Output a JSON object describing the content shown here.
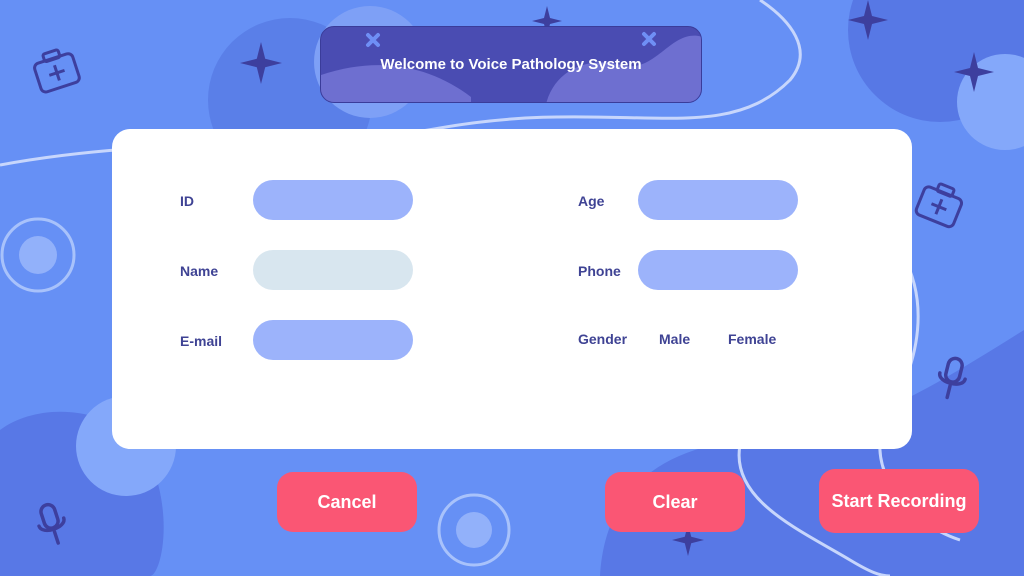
{
  "header": {
    "title": "Welcome to Voice Pathology System"
  },
  "form": {
    "id_label": "ID",
    "name_label": "Name",
    "email_label": "E-mail",
    "age_label": "Age",
    "phone_label": "Phone",
    "gender_label": "Gender",
    "gender_male": "Male",
    "gender_female": "Female",
    "id_value": "",
    "name_value": "",
    "email_value": "",
    "age_value": "",
    "phone_value": ""
  },
  "buttons": {
    "cancel": "Cancel",
    "clear": "Clear",
    "start_recording": "Start Recording"
  },
  "colors": {
    "background": "#6690f5",
    "title_bar": "#4a4cb2",
    "card": "#ffffff",
    "field": "#9cb3fb",
    "field_focused": "#d8e6ef",
    "button": "#fa5674",
    "label": "#3f4394"
  },
  "decorations": {
    "icons": [
      "first-aid-kit-icon",
      "sparkle-icon",
      "microphone-icon",
      "close-icon"
    ]
  }
}
